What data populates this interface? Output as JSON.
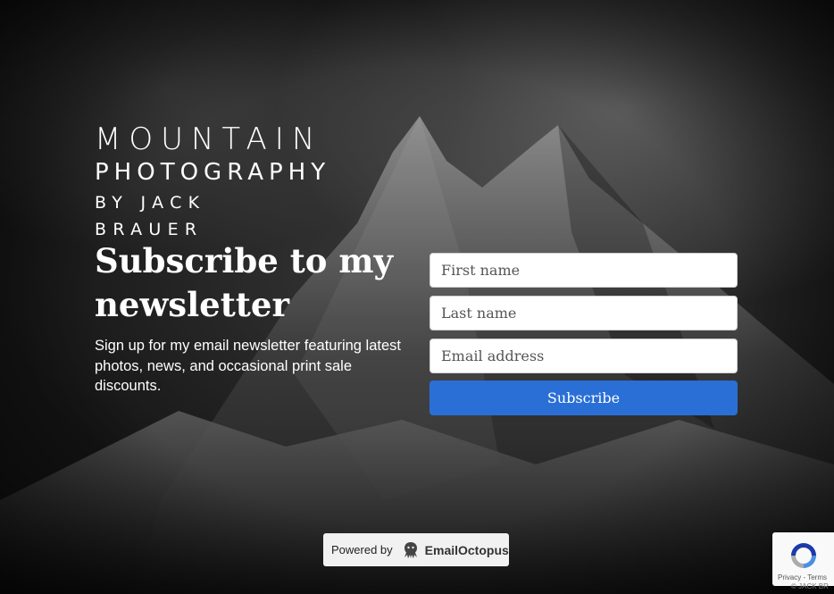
{
  "logo": {
    "line1": "MOUNTAIN",
    "line2": "PHOTOGRAPHY",
    "line3": "BY JACK BRAUER"
  },
  "heading": "Subscribe to my newsletter",
  "description": "Sign up for my email newsletter featuring latest photos, news, and occasional print sale discounts.",
  "form": {
    "first_name_placeholder": "First name",
    "last_name_placeholder": "Last name",
    "email_placeholder": "Email address",
    "submit_label": "Subscribe"
  },
  "powered_by": {
    "prefix": "Powered by",
    "brand": "EmailOctopus"
  },
  "recaptcha": {
    "privacy_label": "Privacy",
    "separator": "-",
    "terms_label": "Terms"
  },
  "copyright": "© JACK BR",
  "colors": {
    "accent": "#2a6fd6",
    "text": "#ffffff"
  },
  "icons": {
    "octopus": "octopus-icon",
    "recaptcha": "recaptcha-icon"
  }
}
